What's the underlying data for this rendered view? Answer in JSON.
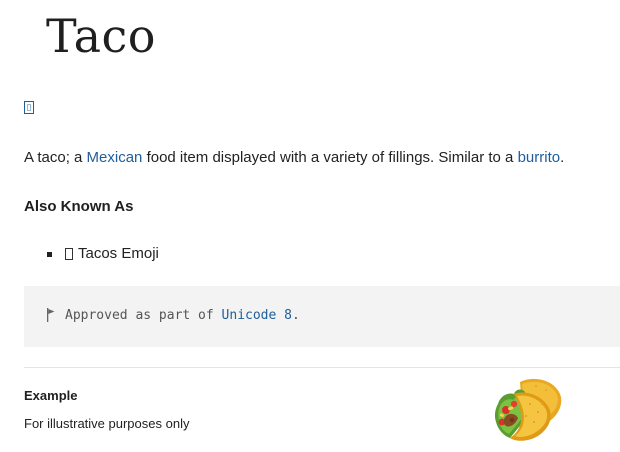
{
  "title": "Taco",
  "description": {
    "before_mexican": "A taco; a ",
    "mexican_link": "Mexican",
    "middle": " food item displayed with a variety of fillings. Similar to a ",
    "burrito_link": "burrito",
    "end": "."
  },
  "also_known_as": {
    "heading": "Also Known As",
    "items": [
      {
        "label": "Tacos Emoji"
      }
    ]
  },
  "note": {
    "icon": "flag-icon",
    "prefix": "Approved as part of ",
    "link": "Unicode 8",
    "suffix": "."
  },
  "example": {
    "heading": "Example",
    "caption": "For illustrative purposes only",
    "image": "taco-emoji"
  },
  "colors": {
    "link": "#1f5e9a",
    "note_background": "#f3f3f3",
    "divider": "#e4e4e4"
  }
}
